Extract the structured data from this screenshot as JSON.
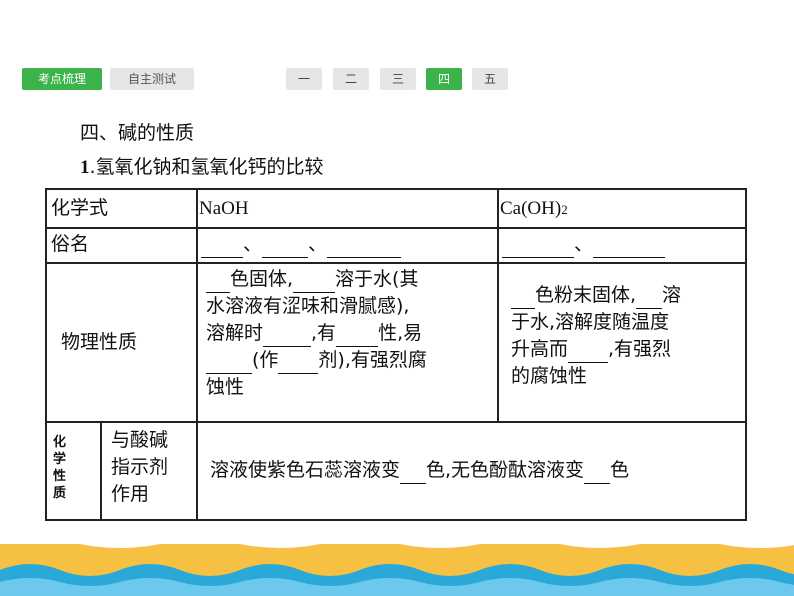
{
  "nav": {
    "tabs": [
      {
        "label": "考点梳理",
        "active": true
      },
      {
        "label": "自主测试",
        "active": false
      }
    ],
    "sections": [
      {
        "label": "一",
        "active": false
      },
      {
        "label": "二",
        "active": false
      },
      {
        "label": "三",
        "active": false
      },
      {
        "label": "四",
        "active": true
      },
      {
        "label": "五",
        "active": false
      }
    ]
  },
  "content": {
    "section_title": "四、碱的性质",
    "subtitle_num": "1",
    "subtitle_text": ".氢氧化钠和氢氧化钙的比较"
  },
  "table": {
    "header_label": "化学式",
    "naoh": "NaOH",
    "caoh2_main": "Ca(OH)",
    "caoh2_sub": "2",
    "common_name_label": "俗名",
    "sep": "、",
    "physical_label": "物理性质",
    "naoh_phys": {
      "l1a": "色固体,",
      "l1b": "溶于水(其",
      "l2": "水溶液有涩味和滑腻感),",
      "l3a": "溶解时",
      "l3b": ",有",
      "l3c": "性,易",
      "l4a": "(作",
      "l4b": "剂),有强烈腐",
      "l5": "蚀性"
    },
    "caoh2_phys": {
      "l1a": "色粉末固体,",
      "l1b": "溶",
      "l2": "于水,溶解度随温度",
      "l3a": "升高而",
      "l3b": ",有强烈",
      "l4": "的腐蚀性"
    },
    "chem_label": "化学性质",
    "indicator_label": [
      "与酸碱",
      "指示剂",
      "作用"
    ],
    "indicator_a": "溶液使紫色石蕊溶液变",
    "indicator_b": "色,无色酚酞溶液变",
    "indicator_c": "色"
  },
  "colors": {
    "accent": "#3bb34a",
    "tab_inactive": "#e6e6e6",
    "band_orange": "#f6c043",
    "band_wave": "#2aa8d8"
  }
}
